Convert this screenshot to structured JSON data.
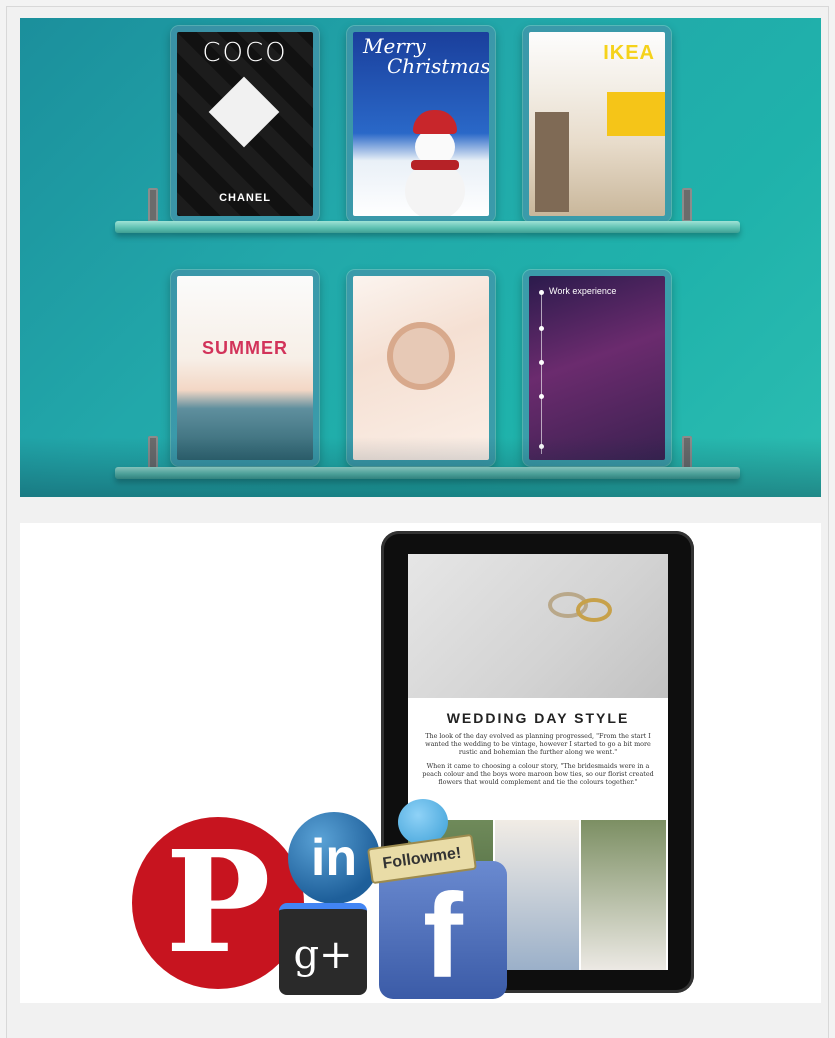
{
  "shelf_cards": {
    "coco": {
      "title": "COCO",
      "brand": "CHANEL"
    },
    "christmas": {
      "title_line1": "Merry",
      "title_line2": "Christmas"
    },
    "ikea": {
      "title": "IKEA"
    },
    "summer": {
      "title": "SUMMER"
    },
    "work": {
      "title": "Work experience"
    }
  },
  "tablet": {
    "headline": "WEDDING DAY STYLE",
    "paragraph1": "The look of the day evolved as planning progressed, \"From the start I wanted the wedding to be vintage, however I started to go a bit more rustic and bohemian the further along we went.\"",
    "paragraph2": "When it came to choosing a colour story, \"The bridesmaids were in a peach colour and the boys wore maroon bow ties, so our florist created flowers that would complement and tie the colours together.\""
  },
  "social": {
    "pinterest": "P",
    "linkedin": "in",
    "googleplus": "g+",
    "facebook": "f",
    "follow": "Followme!"
  },
  "colors": {
    "shelf_bg": "#22a8aa",
    "pinterest": "#c7141f",
    "linkedin": "#1e5f9a",
    "facebook": "#3b5ba7"
  }
}
